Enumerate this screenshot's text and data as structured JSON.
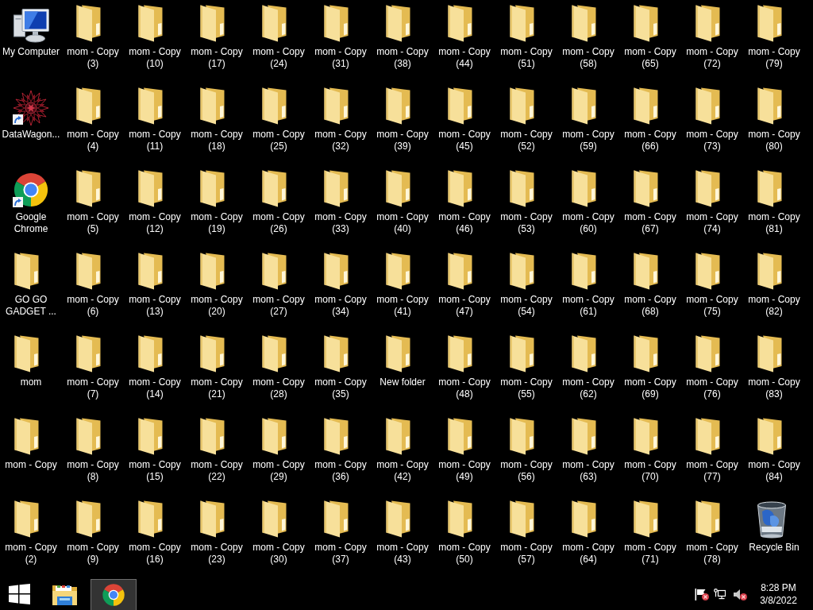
{
  "desktop": {
    "columns": [
      {
        "items": [
          {
            "kind": "computer",
            "label": "My Computer",
            "shortcut": false
          },
          {
            "kind": "app",
            "label": "DataWagon...",
            "shortcut": true
          },
          {
            "kind": "chrome",
            "label": "Google Chrome",
            "shortcut": true
          },
          {
            "kind": "folder",
            "label": "GO GO GADGET ...",
            "shortcut": false
          },
          {
            "kind": "folder",
            "label": "mom",
            "shortcut": false
          },
          {
            "kind": "folder",
            "label": "mom - Copy",
            "shortcut": false
          },
          {
            "kind": "folder",
            "label": "mom - Copy (2)",
            "shortcut": false
          }
        ]
      },
      {
        "items": [
          {
            "kind": "folder",
            "label": "mom - Copy (3)",
            "shortcut": false
          },
          {
            "kind": "folder",
            "label": "mom - Copy (4)",
            "shortcut": false
          },
          {
            "kind": "folder",
            "label": "mom - Copy (5)",
            "shortcut": false
          },
          {
            "kind": "folder",
            "label": "mom - Copy (6)",
            "shortcut": false
          },
          {
            "kind": "folder",
            "label": "mom - Copy (7)",
            "shortcut": false
          },
          {
            "kind": "folder",
            "label": "mom - Copy (8)",
            "shortcut": false
          },
          {
            "kind": "folder",
            "label": "mom - Copy (9)",
            "shortcut": false
          }
        ]
      },
      {
        "items": [
          {
            "kind": "folder",
            "label": "mom - Copy (10)",
            "shortcut": false
          },
          {
            "kind": "folder",
            "label": "mom - Copy (11)",
            "shortcut": false
          },
          {
            "kind": "folder",
            "label": "mom - Copy (12)",
            "shortcut": false
          },
          {
            "kind": "folder",
            "label": "mom - Copy (13)",
            "shortcut": false
          },
          {
            "kind": "folder",
            "label": "mom - Copy (14)",
            "shortcut": false
          },
          {
            "kind": "folder",
            "label": "mom - Copy (15)",
            "shortcut": false
          },
          {
            "kind": "folder",
            "label": "mom - Copy (16)",
            "shortcut": false
          }
        ]
      },
      {
        "items": [
          {
            "kind": "folder",
            "label": "mom - Copy (17)",
            "shortcut": false
          },
          {
            "kind": "folder",
            "label": "mom - Copy (18)",
            "shortcut": false
          },
          {
            "kind": "folder",
            "label": "mom - Copy (19)",
            "shortcut": false
          },
          {
            "kind": "folder",
            "label": "mom - Copy (20)",
            "shortcut": false
          },
          {
            "kind": "folder",
            "label": "mom - Copy (21)",
            "shortcut": false
          },
          {
            "kind": "folder",
            "label": "mom - Copy (22)",
            "shortcut": false
          },
          {
            "kind": "folder",
            "label": "mom - Copy (23)",
            "shortcut": false
          }
        ]
      },
      {
        "items": [
          {
            "kind": "folder",
            "label": "mom - Copy (24)",
            "shortcut": false
          },
          {
            "kind": "folder",
            "label": "mom - Copy (25)",
            "shortcut": false
          },
          {
            "kind": "folder",
            "label": "mom - Copy (26)",
            "shortcut": false
          },
          {
            "kind": "folder",
            "label": "mom - Copy (27)",
            "shortcut": false
          },
          {
            "kind": "folder",
            "label": "mom - Copy (28)",
            "shortcut": false
          },
          {
            "kind": "folder",
            "label": "mom - Copy (29)",
            "shortcut": false
          },
          {
            "kind": "folder",
            "label": "mom - Copy (30)",
            "shortcut": false
          }
        ]
      },
      {
        "items": [
          {
            "kind": "folder",
            "label": "mom - Copy (31)",
            "shortcut": false
          },
          {
            "kind": "folder",
            "label": "mom - Copy (32)",
            "shortcut": false
          },
          {
            "kind": "folder",
            "label": "mom - Copy (33)",
            "shortcut": false
          },
          {
            "kind": "folder",
            "label": "mom - Copy (34)",
            "shortcut": false
          },
          {
            "kind": "folder",
            "label": "mom - Copy (35)",
            "shortcut": false
          },
          {
            "kind": "folder",
            "label": "mom - Copy (36)",
            "shortcut": false
          },
          {
            "kind": "folder",
            "label": "mom - Copy (37)",
            "shortcut": false
          }
        ]
      },
      {
        "items": [
          {
            "kind": "folder",
            "label": "mom - Copy (38)",
            "shortcut": false
          },
          {
            "kind": "folder",
            "label": "mom - Copy (39)",
            "shortcut": false
          },
          {
            "kind": "folder",
            "label": "mom - Copy (40)",
            "shortcut": false
          },
          {
            "kind": "folder",
            "label": "mom - Copy (41)",
            "shortcut": false
          },
          {
            "kind": "folder",
            "label": "New folder",
            "shortcut": false
          },
          {
            "kind": "folder",
            "label": "mom - Copy (42)",
            "shortcut": false
          },
          {
            "kind": "folder",
            "label": "mom - Copy (43)",
            "shortcut": false
          }
        ]
      },
      {
        "items": [
          {
            "kind": "folder",
            "label": "mom - Copy (44)",
            "shortcut": false
          },
          {
            "kind": "folder",
            "label": "mom - Copy (45)",
            "shortcut": false
          },
          {
            "kind": "folder",
            "label": "mom - Copy (46)",
            "shortcut": false
          },
          {
            "kind": "folder",
            "label": "mom - Copy (47)",
            "shortcut": false
          },
          {
            "kind": "folder",
            "label": "mom - Copy (48)",
            "shortcut": false
          },
          {
            "kind": "folder",
            "label": "mom - Copy (49)",
            "shortcut": false
          },
          {
            "kind": "folder",
            "label": "mom - Copy (50)",
            "shortcut": false
          }
        ]
      },
      {
        "items": [
          {
            "kind": "folder",
            "label": "mom - Copy (51)",
            "shortcut": false
          },
          {
            "kind": "folder",
            "label": "mom - Copy (52)",
            "shortcut": false
          },
          {
            "kind": "folder",
            "label": "mom - Copy (53)",
            "shortcut": false
          },
          {
            "kind": "folder",
            "label": "mom - Copy (54)",
            "shortcut": false
          },
          {
            "kind": "folder",
            "label": "mom - Copy (55)",
            "shortcut": false
          },
          {
            "kind": "folder",
            "label": "mom - Copy (56)",
            "shortcut": false
          },
          {
            "kind": "folder",
            "label": "mom - Copy (57)",
            "shortcut": false
          }
        ]
      },
      {
        "items": [
          {
            "kind": "folder",
            "label": "mom - Copy (58)",
            "shortcut": false
          },
          {
            "kind": "folder",
            "label": "mom - Copy (59)",
            "shortcut": false
          },
          {
            "kind": "folder",
            "label": "mom - Copy (60)",
            "shortcut": false
          },
          {
            "kind": "folder",
            "label": "mom - Copy (61)",
            "shortcut": false
          },
          {
            "kind": "folder",
            "label": "mom - Copy (62)",
            "shortcut": false
          },
          {
            "kind": "folder",
            "label": "mom - Copy (63)",
            "shortcut": false
          },
          {
            "kind": "folder",
            "label": "mom - Copy (64)",
            "shortcut": false
          }
        ]
      },
      {
        "items": [
          {
            "kind": "folder",
            "label": "mom - Copy (65)",
            "shortcut": false
          },
          {
            "kind": "folder",
            "label": "mom - Copy (66)",
            "shortcut": false
          },
          {
            "kind": "folder",
            "label": "mom - Copy (67)",
            "shortcut": false
          },
          {
            "kind": "folder",
            "label": "mom - Copy (68)",
            "shortcut": false
          },
          {
            "kind": "folder",
            "label": "mom - Copy (69)",
            "shortcut": false
          },
          {
            "kind": "folder",
            "label": "mom - Copy (70)",
            "shortcut": false
          },
          {
            "kind": "folder",
            "label": "mom - Copy (71)",
            "shortcut": false
          }
        ]
      },
      {
        "items": [
          {
            "kind": "folder",
            "label": "mom - Copy (72)",
            "shortcut": false
          },
          {
            "kind": "folder",
            "label": "mom - Copy (73)",
            "shortcut": false
          },
          {
            "kind": "folder",
            "label": "mom - Copy (74)",
            "shortcut": false
          },
          {
            "kind": "folder",
            "label": "mom - Copy (75)",
            "shortcut": false
          },
          {
            "kind": "folder",
            "label": "mom - Copy (76)",
            "shortcut": false
          },
          {
            "kind": "folder",
            "label": "mom - Copy (77)",
            "shortcut": false
          },
          {
            "kind": "folder",
            "label": "mom - Copy (78)",
            "shortcut": false
          }
        ]
      },
      {
        "items": [
          {
            "kind": "folder",
            "label": "mom - Copy (79)",
            "shortcut": false
          },
          {
            "kind": "folder",
            "label": "mom - Copy (80)",
            "shortcut": false
          },
          {
            "kind": "folder",
            "label": "mom - Copy (81)",
            "shortcut": false
          },
          {
            "kind": "folder",
            "label": "mom - Copy (82)",
            "shortcut": false
          },
          {
            "kind": "folder",
            "label": "mom - Copy (83)",
            "shortcut": false
          },
          {
            "kind": "folder",
            "label": "mom - Copy (84)",
            "shortcut": false
          },
          {
            "kind": "recycle_bin",
            "label": "Recycle Bin",
            "shortcut": false
          }
        ]
      }
    ]
  },
  "taskbar": {
    "pinned": [
      {
        "kind": "file_explorer",
        "active": false
      },
      {
        "kind": "chrome",
        "active": true
      }
    ],
    "tray": [
      {
        "kind": "flag",
        "alert": true
      },
      {
        "kind": "network",
        "alert": false
      },
      {
        "kind": "volume",
        "alert": true
      }
    ],
    "clock": {
      "time": "8:28 PM",
      "date": "3/8/2022"
    }
  }
}
